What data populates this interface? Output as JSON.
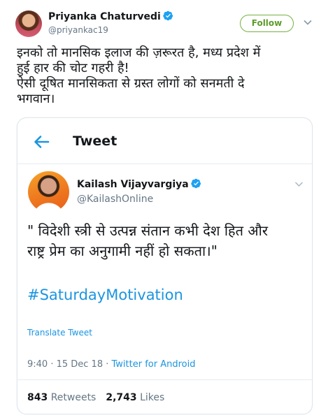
{
  "outer_tweet": {
    "author_name": "Priyanka Chaturvedi",
    "author_handle": "@priyankac19",
    "follow_label": "Follow",
    "text_lines": [
      "इनको तो मानसिक इलाज की ज़रूरत है, मध्य प्रदेश में",
      "हुई हार की चोट गहरी है!",
      "ऐसी दूषित मानसिकता से ग्रस्त लोगों को सनमती दे",
      "भगवान।"
    ]
  },
  "embedded_screenshot": {
    "header_title": "Tweet",
    "author_name": "Kailash Vijayvargiya",
    "author_handle": "@KailashOnline",
    "text_lines": [
      "\" विदेशी स्त्री से उत्पन्न संतान कभी देश हित और",
      "राष्ट्र प्रेम का अनुगामी नहीं हो सकता।\""
    ],
    "hashtag": "#SaturdayMotivation",
    "translate_label": "Translate Tweet",
    "timestamp": "9:40 · 15 Dec 18 ·",
    "client": "Twitter for Android",
    "retweet_count": "843",
    "retweet_label": "Retweets",
    "like_count": "2,743",
    "like_label": "Likes"
  },
  "colors": {
    "link": "#1b95e0",
    "verified": "#1da1f2",
    "follow_border": "#76b13f",
    "secondary_text": "#657786"
  },
  "icons": [
    "verified-badge-icon",
    "chevron-down-icon",
    "back-arrow-icon"
  ]
}
